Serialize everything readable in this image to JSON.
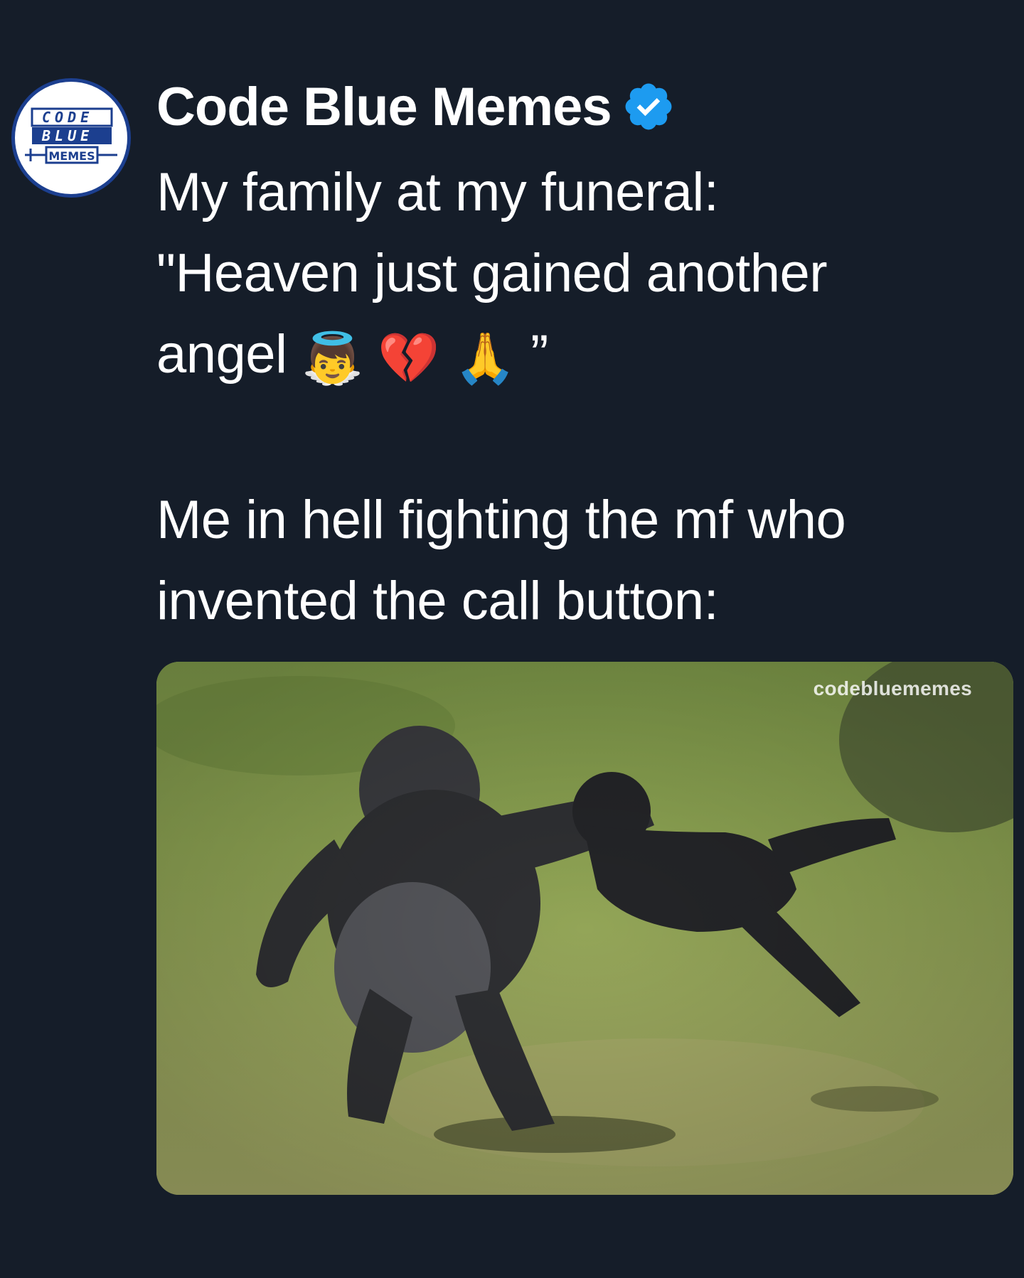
{
  "tweet": {
    "author": {
      "display_name": "Code Blue Memes",
      "verified": true,
      "avatar_logo_text": [
        "CODE",
        "BLUE",
        "MEMES"
      ]
    },
    "text": {
      "line1": "My family at my funeral:",
      "line2": "\"Heaven just gained another",
      "line3_text": "angel",
      "line3_emojis": [
        "👼",
        "💔",
        "🙏"
      ],
      "line3_close": "”",
      "line4": "Me in hell fighting the mf who",
      "line5": "invented the call button:"
    },
    "media": {
      "watermark": "codebluememes",
      "type": "image",
      "subject": "gorilla"
    }
  },
  "colors": {
    "background": "#151d29",
    "text": "#ffffff",
    "verified_badge": "#1d9bf0",
    "logo_blue": "#1c3f8f"
  }
}
